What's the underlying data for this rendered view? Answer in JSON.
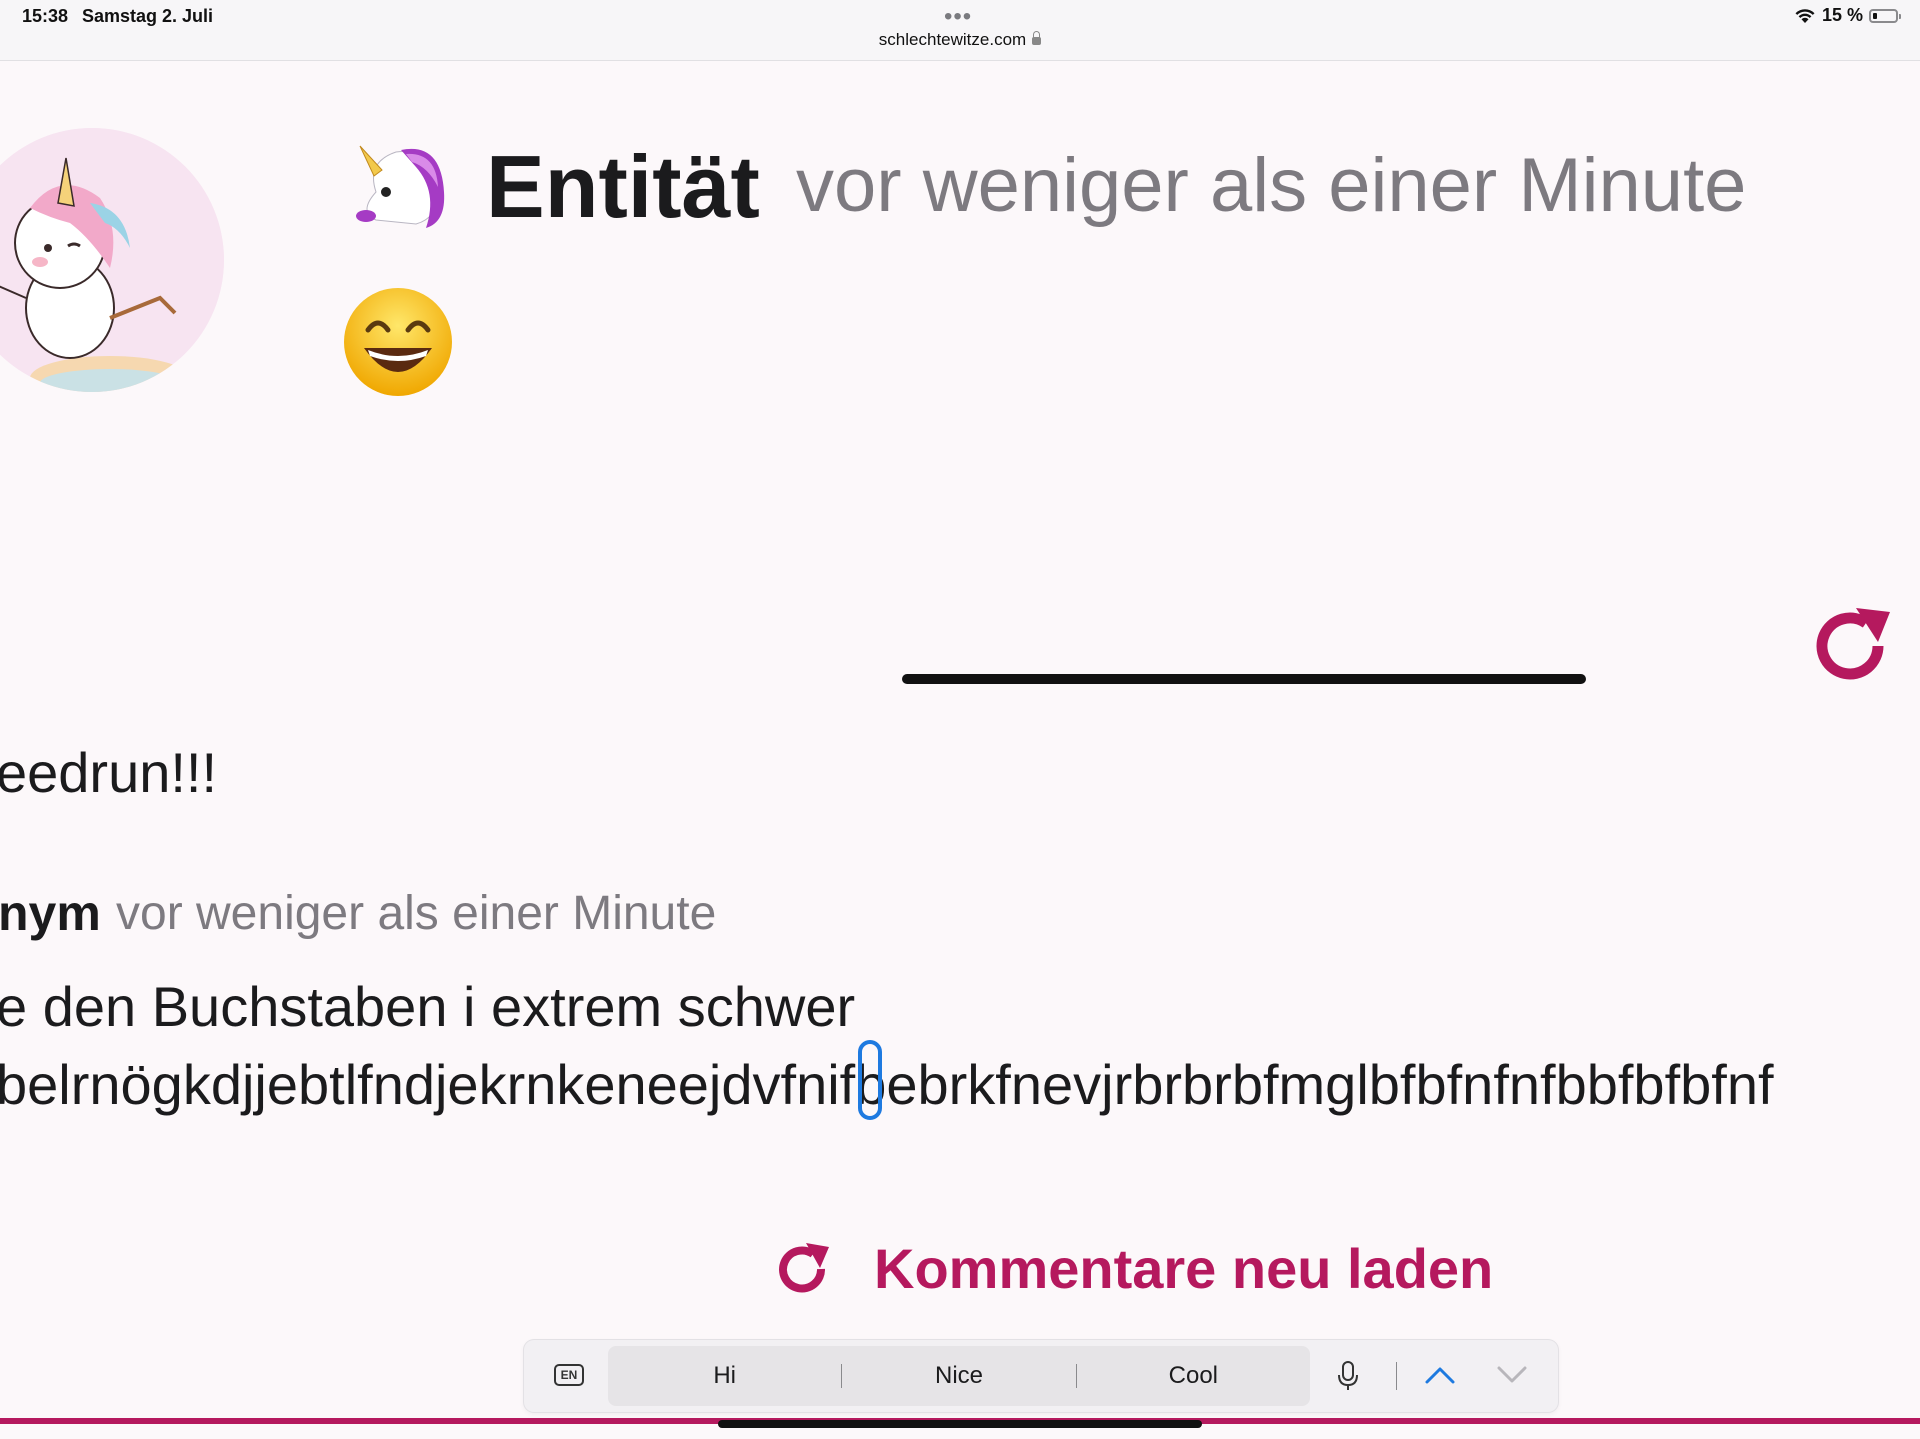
{
  "status_bar": {
    "time": "15:38",
    "date": "Samstag 2. Juli",
    "url": "schlechtewitze.com",
    "battery": "15 %"
  },
  "post": {
    "author_emoji_icon": "unicorn-icon",
    "author_name": "Entität",
    "time": "vor weniger als einer Minute",
    "content_emoji_icon": "grinning-face-icon"
  },
  "comments": [
    {
      "text": "eedrun!!!"
    },
    {
      "author": "nym",
      "time": "vor weniger als einer Minute",
      "line1": "e den Buchstaben i extrem schwer",
      "line2": "belrnögkdjjebtlfndjekrnkeneejdvfnifbebrkfnevjrbrbrbfmglbfbfnfnfbbfbfbfnf"
    }
  ],
  "reload_comments": {
    "label": "Kommentare neu laden"
  },
  "keyboard": {
    "lang": "EN",
    "suggestions": [
      "Hi",
      "Nice",
      "Cool"
    ]
  },
  "colors": {
    "accent": "#b5195e",
    "cursor": "#1e7ae0"
  }
}
